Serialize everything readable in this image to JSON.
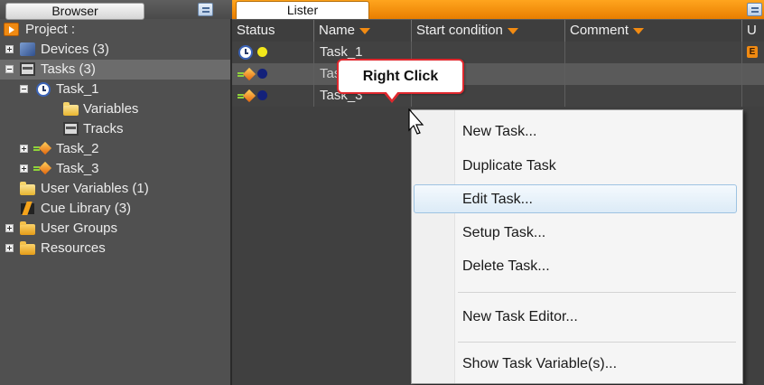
{
  "browser": {
    "tab_label": "Browser",
    "tree": [
      {
        "label": "Project :",
        "icon": "project-icon"
      },
      {
        "label": "Devices (3)",
        "icon": "devices-icon",
        "expander": "plus"
      },
      {
        "label": "Tasks (3)",
        "icon": "tasks-icon",
        "expander": "minus",
        "selected": true
      },
      {
        "label": "Task_1",
        "icon": "clock-icon",
        "expander": "minus"
      },
      {
        "label": "Variables",
        "icon": "folder-icon"
      },
      {
        "label": "Tracks",
        "icon": "tracks-icon"
      },
      {
        "label": "Task_2",
        "icon": "task-icon",
        "expander": "plus"
      },
      {
        "label": "Task_3",
        "icon": "task-icon",
        "expander": "plus"
      },
      {
        "label": "User Variables (1)",
        "icon": "folder-icon"
      },
      {
        "label": "Cue Library (3)",
        "icon": "cue-library-icon"
      },
      {
        "label": "User Groups",
        "icon": "folder-icon",
        "expander": "plus"
      },
      {
        "label": "Resources",
        "icon": "folder-icon",
        "expander": "plus"
      }
    ]
  },
  "lister": {
    "tab_label": "Lister",
    "columns": [
      "Status",
      "Name",
      "Start condition",
      "Comment",
      "U"
    ],
    "rows": [
      {
        "name": "Task_1",
        "status_icon": "clock-icon",
        "dot_color": "#f3e81a",
        "flag": "E"
      },
      {
        "name": "Task_2",
        "status_icon": "task-icon",
        "dot_color": "#13217a"
      },
      {
        "name": "Task_3",
        "status_icon": "task-icon",
        "dot_color": "#13217a"
      }
    ]
  },
  "callout": {
    "text": "Right Click"
  },
  "context_menu": {
    "items": [
      "New Task...",
      "Duplicate Task",
      "Edit Task...",
      "Setup Task...",
      "Delete Task...",
      "New Task Editor...",
      "Show Task Variable(s)..."
    ],
    "highlighted": "Edit Task..."
  },
  "colors": {
    "accent_orange": "#f08a12",
    "callout_border": "#e0282e",
    "menu_highlight_border": "#9ec3e2"
  }
}
